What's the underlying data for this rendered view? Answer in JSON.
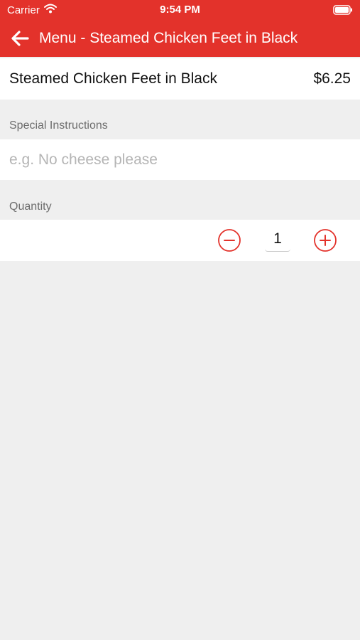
{
  "status_bar": {
    "carrier": "Carrier",
    "time": "9:54 PM"
  },
  "header": {
    "title": "Menu - Steamed Chicken Feet in Black",
    "background_color": "#e3322b"
  },
  "item": {
    "name": "Steamed Chicken Feet in Black",
    "price": "$6.25"
  },
  "special_instructions": {
    "label": "Special Instructions",
    "placeholder": "e.g. No cheese please",
    "value": ""
  },
  "quantity": {
    "label": "Quantity",
    "value": "1"
  },
  "icons": {
    "back": "arrow-left-icon",
    "decrement": "minus-circle-icon",
    "increment": "plus-circle-icon",
    "wifi": "wifi-icon",
    "battery": "battery-icon"
  }
}
